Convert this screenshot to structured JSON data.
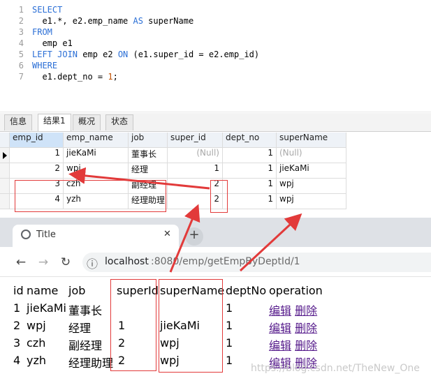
{
  "editor": {
    "line_numbers": [
      "1",
      "2",
      "3",
      "4",
      "5",
      "6",
      "7"
    ],
    "lines": [
      {
        "kw": "SELECT",
        "rest": ""
      },
      {
        "kw": "",
        "rest": "  e1.*, e2.emp_name ",
        "kw2": "AS",
        "rest2": " superName"
      },
      {
        "kw": "FROM",
        "rest": ""
      },
      {
        "kw": "",
        "rest": "  emp e1"
      },
      {
        "kw": "LEFT JOIN",
        "rest": " emp e2 ",
        "kw2": "ON",
        "rest2": " (e1.super_id = e2.emp_id)"
      },
      {
        "kw": "WHERE",
        "rest": ""
      },
      {
        "kw": "",
        "rest": "  e1.dept_no = ",
        "num": "1",
        "rest2": ";"
      }
    ]
  },
  "result_tabs": [
    "信息",
    "结果1",
    "概况",
    "状态"
  ],
  "grid": {
    "columns": [
      "emp_id",
      "emp_name",
      "job",
      "super_id",
      "dept_no",
      "superName"
    ],
    "rows": [
      [
        "1",
        "jieKaMi",
        "董事长",
        "(Null)",
        "1",
        "(Null)"
      ],
      [
        "2",
        "wpj",
        "经理",
        "1",
        "1",
        "jieKaMi"
      ],
      [
        "3",
        "czh",
        "副经理",
        "2",
        "1",
        "wpj"
      ],
      [
        "4",
        "yzh",
        "经理助理",
        "2",
        "1",
        "wpj"
      ]
    ]
  },
  "browser": {
    "tab_title": "Title",
    "close_glyph": "✕",
    "new_tab_glyph": "+",
    "url_host": "localhost",
    "url_rest": ":8080/emp/getEmpByDeptId/1",
    "back_glyph": "←",
    "forward_glyph": "→",
    "reload_glyph": "↻",
    "info_glyph": "ⓘ"
  },
  "page_table": {
    "headers": [
      "id",
      "name",
      "job",
      "superId",
      "superName",
      "deptNo",
      "operation"
    ],
    "rows": [
      [
        "1",
        "jieKaMi",
        "董事长",
        "",
        "",
        "1"
      ],
      [
        "2",
        "wpj",
        "经理",
        "1",
        "jieKaMi",
        "1"
      ],
      [
        "3",
        "czh",
        "副经理",
        "2",
        "wpj",
        "1"
      ],
      [
        "4",
        "yzh",
        "经理助理",
        "2",
        "wpj",
        "1"
      ]
    ],
    "edit_label": "编辑",
    "delete_label": "删除"
  },
  "watermark": "https://blog.csdn.net/TheNew_One",
  "colors": {
    "annotation_red": "#e23a3a",
    "sql_keyword": "#2b6fd6",
    "link": "#551a8b"
  }
}
